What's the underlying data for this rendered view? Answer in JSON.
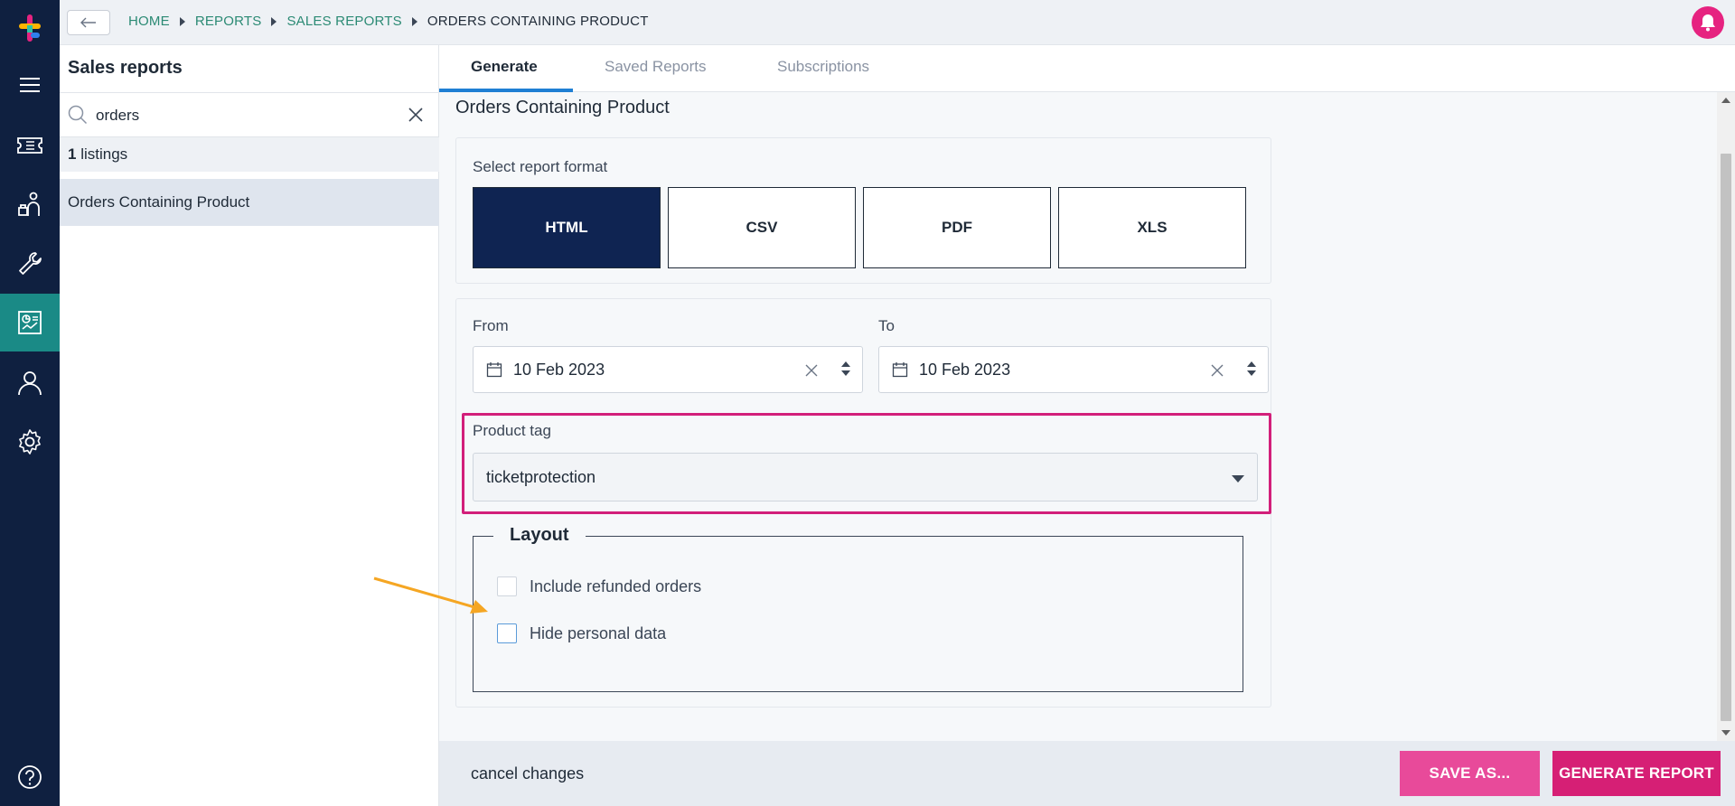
{
  "breadcrumbs": {
    "home": "HOME",
    "reports": "REPORTS",
    "sales_reports": "SALES REPORTS",
    "current": "ORDERS CONTAINING PRODUCT"
  },
  "sidebar": {
    "title": "Sales reports",
    "search_value": "orders",
    "count": "1",
    "count_suffix": "listings",
    "items": [
      {
        "label": "Orders Containing Product"
      }
    ]
  },
  "tabs": [
    {
      "label": "Generate",
      "active": true
    },
    {
      "label": "Saved Reports",
      "active": false
    },
    {
      "label": "Subscriptions",
      "active": false
    }
  ],
  "report": {
    "title": "Orders Containing Product",
    "format_label": "Select report format",
    "formats": [
      {
        "label": "HTML",
        "selected": true
      },
      {
        "label": "CSV",
        "selected": false
      },
      {
        "label": "PDF",
        "selected": false
      },
      {
        "label": "XLS",
        "selected": false
      }
    ],
    "from_label": "From",
    "from_value": "10 Feb 2023",
    "to_label": "To",
    "to_value": "10 Feb 2023",
    "product_tag_label": "Product tag",
    "product_tag_value": "ticketprotection",
    "layout": {
      "legend": "Layout",
      "options": [
        {
          "label": "Include refunded orders",
          "checked": false
        },
        {
          "label": "Hide personal data",
          "checked": false
        }
      ]
    }
  },
  "footer": {
    "cancel": "cancel changes",
    "save_as": "SAVE AS...",
    "generate": "GENERATE REPORT"
  },
  "colors": {
    "rail": "#0f2040",
    "rail_active": "#1a8a86",
    "accent_link": "#2b8a74",
    "highlight_border": "#d21f7a",
    "primary_button": "#d61f75",
    "secondary_button": "#e84a9a",
    "format_selected": "#0f2452",
    "annotation_arrow": "#f5a623"
  },
  "icons": {
    "rail": [
      "app-logo-icon",
      "menu-icon",
      "ticket-icon",
      "attendee-icon",
      "wrench-icon",
      "reports-icon",
      "user-icon",
      "settings-icon",
      "help-icon"
    ],
    "top": [
      "back-arrow-icon",
      "bell-icon"
    ]
  }
}
